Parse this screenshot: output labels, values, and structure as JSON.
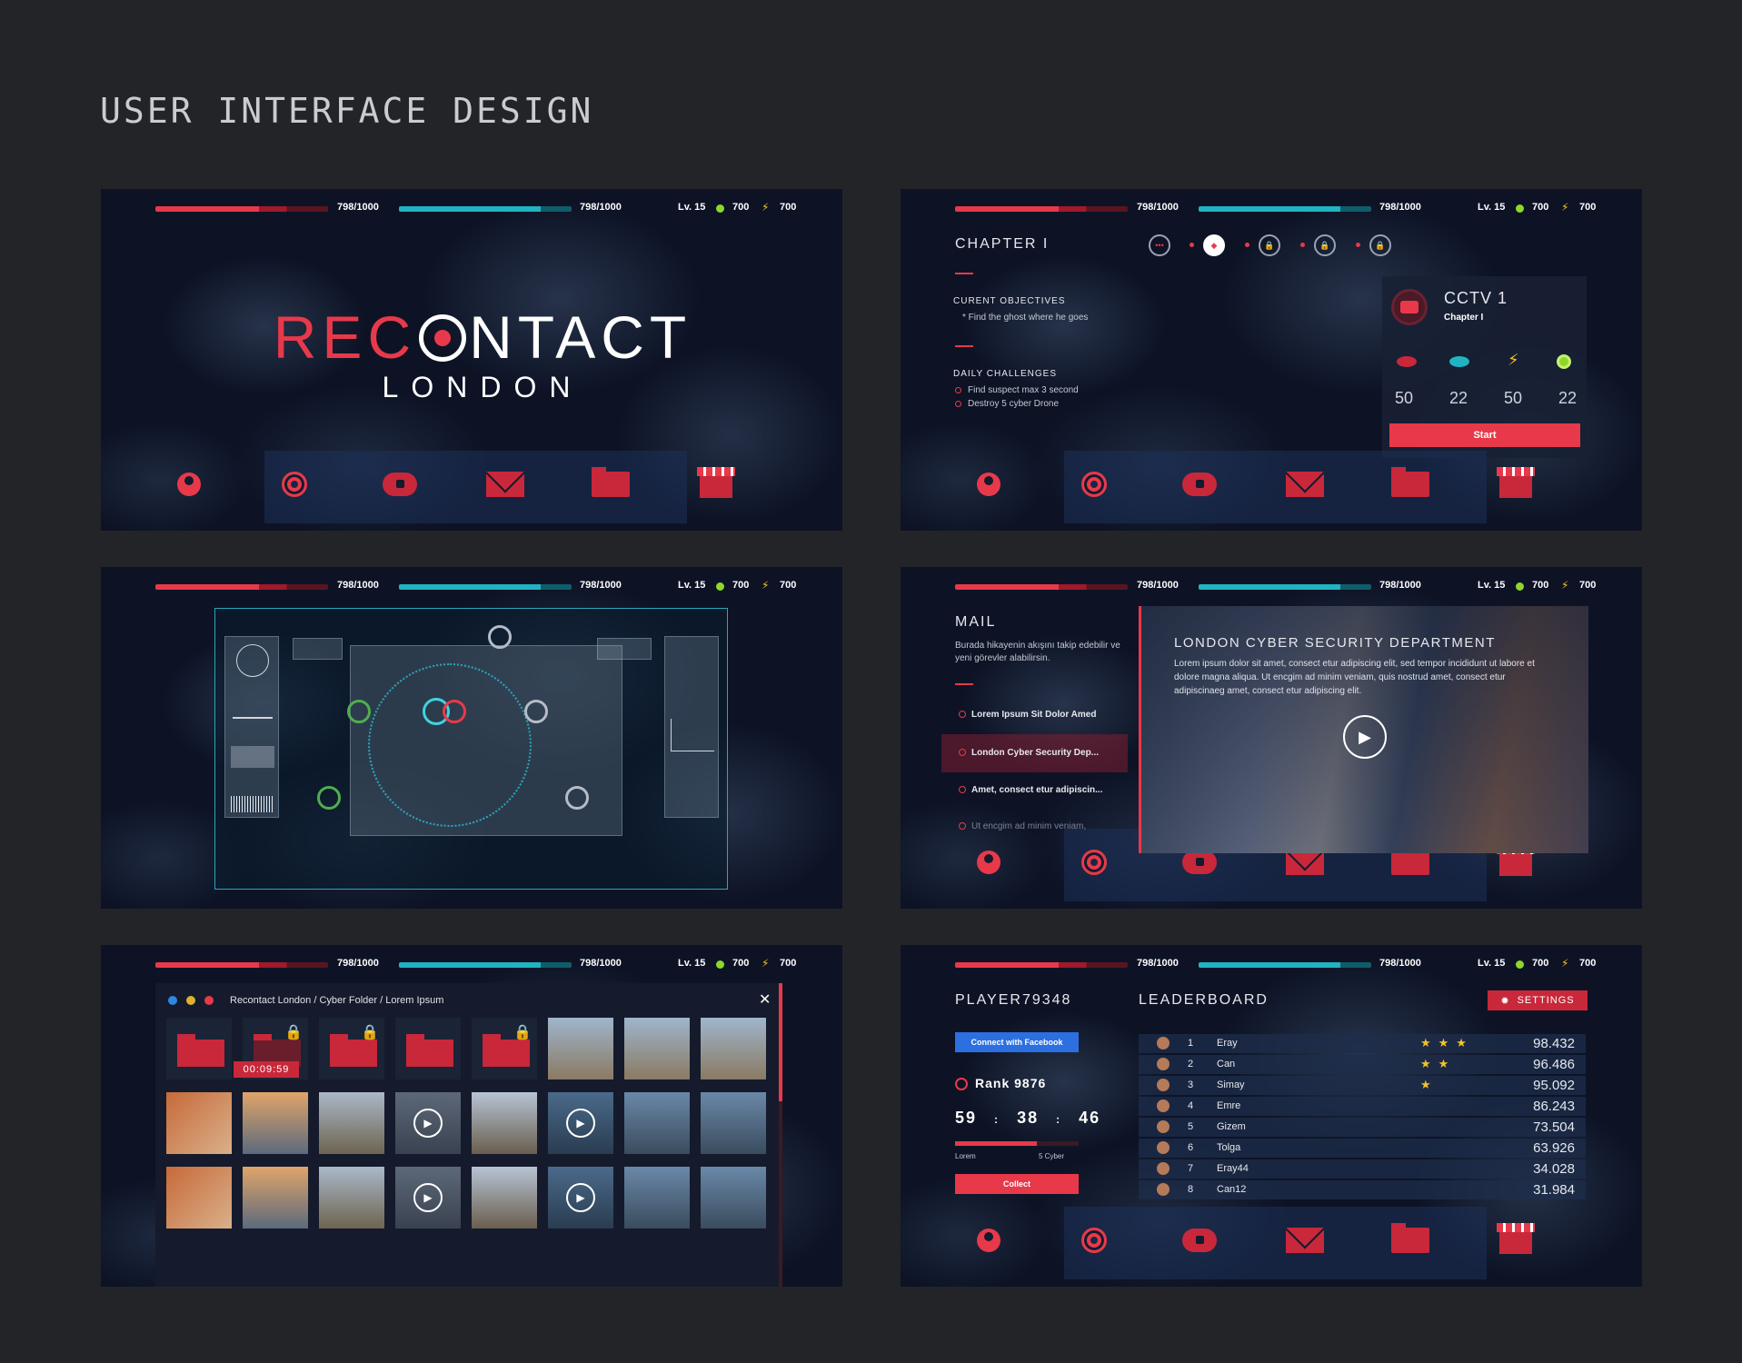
{
  "page_title": "USER INTERFACE DESIGN",
  "hud": {
    "health": "798/1000",
    "energy": "798/1000",
    "level": "Lv. 15",
    "coins": "700",
    "bolts": "700"
  },
  "logo": {
    "rec": "REC",
    "ntact": "NTACT",
    "sub": "LONDON"
  },
  "chapter": {
    "title": "CHAPTER I",
    "obj_title": "CURENT OBJECTIVES",
    "obj_item": "* Find the ghost where he goes",
    "daily_title": "DAILY CHALLENGES",
    "daily_1": "Find suspect max 3 second",
    "daily_2": "Destroy 5 cyber Drone",
    "card_title": "CCTV 1",
    "card_sub": "Chapter I",
    "stats": [
      "50",
      "22",
      "50",
      "22"
    ],
    "start": "Start"
  },
  "mail": {
    "title": "MAIL",
    "desc": "Burada hikayenin akışını takip edebilir ve yeni görevler alabilirsin.",
    "items": [
      "Lorem Ipsum Sit Dolor Amed",
      "London Cyber Security Dep...",
      "Amet, consect etur adipiscin...",
      "Ut encgim ad minim veniam,"
    ],
    "video_title": "LONDON CYBER SECURITY DEPARTMENT",
    "video_text": "Lorem ipsum dolor sit amet, consect etur adipiscing elit, sed  tempor incididunt ut labore  et dolore magna aliqua. Ut encgim ad minim veniam, quis nostrud amet, consect etur adipiscinaeg amet, consect etur adipiscing elit."
  },
  "folder": {
    "path": "Recontact London / Cyber Folder / Lorem Ipsum",
    "timer": "00:09:59",
    "close": "✕"
  },
  "profile": {
    "player": "PLAYER79348",
    "facebook": "Connect with Facebook",
    "rank": "Rank 9876",
    "time_h": "59",
    "time_m": "38",
    "time_s": "46",
    "sep": ":",
    "prog_left": "Lorem",
    "prog_right": "5 Cyber",
    "collect": "Collect"
  },
  "leaderboard": {
    "title": "LEADERBOARD",
    "settings": "SETTINGS",
    "rows": [
      {
        "rank": "1",
        "name": "Eray",
        "stars": "★★★",
        "score": "98.432"
      },
      {
        "rank": "2",
        "name": "Can",
        "stars": "★★",
        "score": "96.486"
      },
      {
        "rank": "3",
        "name": "Simay",
        "stars": "★",
        "score": "95.092"
      },
      {
        "rank": "4",
        "name": "Emre",
        "stars": "",
        "score": "86.243"
      },
      {
        "rank": "5",
        "name": "Gizem",
        "stars": "",
        "score": "73.504"
      },
      {
        "rank": "6",
        "name": "Tolga",
        "stars": "",
        "score": "63.926"
      },
      {
        "rank": "7",
        "name": "Eray44",
        "stars": "",
        "score": "34.028"
      },
      {
        "rank": "8",
        "name": "Can12",
        "stars": "",
        "score": "31.984"
      }
    ]
  },
  "colors": {
    "accent": "#e8394a",
    "cyan": "#20b3c2",
    "bg": "#232428"
  }
}
